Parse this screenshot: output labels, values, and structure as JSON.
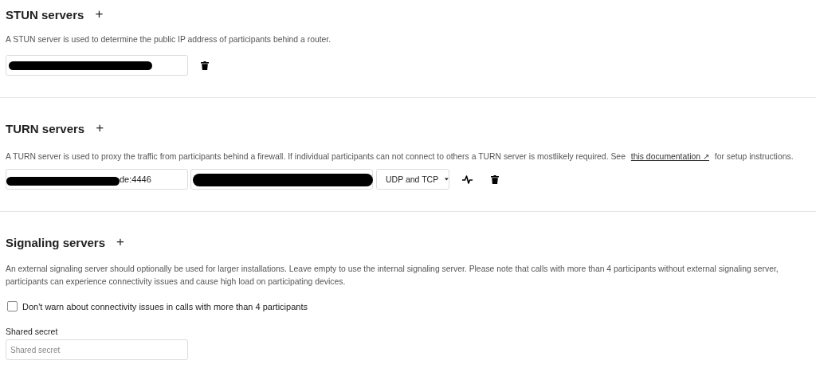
{
  "stun": {
    "title": "STUN servers",
    "add": "+",
    "description": "A STUN server is used to determine the public IP address of participants behind a router.",
    "servers": [
      {
        "redacted": true
      }
    ]
  },
  "turn": {
    "title": "TURN servers",
    "add": "+",
    "description": "A TURN server is used to proxy the traffic from participants behind a firewall. If individual participants can not connect to others a TURN server is mostlikely required. See",
    "link": "this documentation ↗",
    "description_end": "for setup instructions.",
    "servers": [
      {
        "server": {
          "redacted": true,
          "value": "de:4446"
        },
        "secret": {
          "redacted": true
        },
        "protocol": "UDP and TCP"
      }
    ]
  },
  "signaling": {
    "title": "Signaling servers",
    "add": "+",
    "description": "An external signaling server should optionally be used for larger installations. Leave empty to use the internal signaling server. Please note that calls with more than 4 participants without external signaling server, participants can experience connectivity issues and cause high load on participating devices.",
    "checkbox": {
      "label": "Don't warn about connectivity issues in calls with more than 4 participants",
      "checked": false
    },
    "secret_label": "Shared secret",
    "secret_placeholder": "Shared secret"
  }
}
